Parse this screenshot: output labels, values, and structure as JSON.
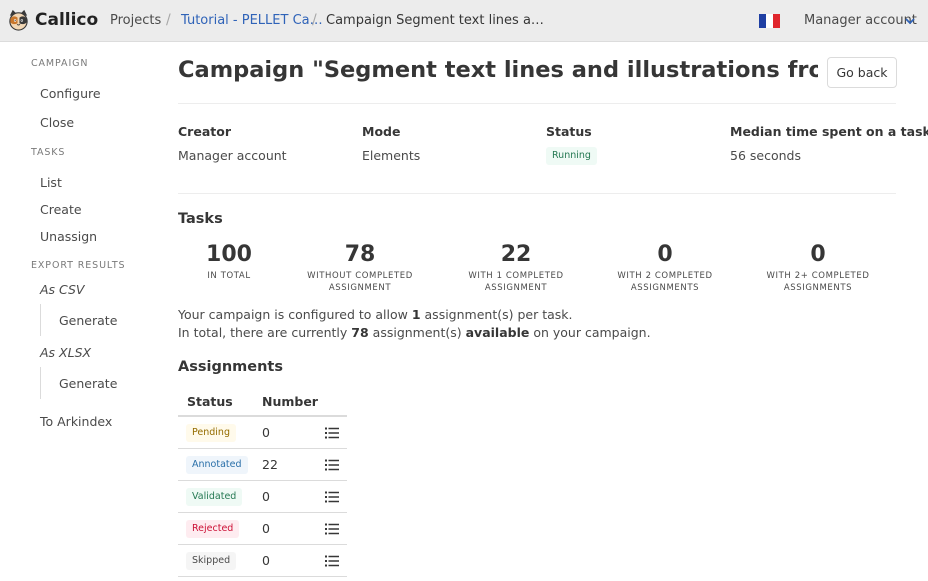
{
  "header": {
    "brand": "Callico",
    "breadcrumbs": [
      "Projects",
      "Tutorial - PELLET Ca…",
      "Campaign Segment text lines a…"
    ],
    "account": "Manager account",
    "language_flag": "fr"
  },
  "sidebar": {
    "campaign_label": "CAMPAIGN",
    "campaign_items": [
      "Configure",
      "Close"
    ],
    "tasks_label": "TASKS",
    "tasks_items": [
      "List",
      "Create",
      "Unassign"
    ],
    "export_label": "EXPORT RESULTS",
    "export_csv": "As CSV",
    "export_csv_sub": "Generate",
    "export_xlsx": "As XLSX",
    "export_xlsx_sub": "Generate",
    "arkindex": "To Arkindex"
  },
  "main": {
    "title": "Campaign \"Segment text lines and illustrations from ...",
    "go_back": "Go back",
    "info": {
      "creator_label": "Creator",
      "creator_value": "Manager account",
      "mode_label": "Mode",
      "mode_value": "Elements",
      "status_label": "Status",
      "status_value": "Running",
      "median_label": "Median time spent on a task",
      "median_value": "56 seconds"
    },
    "tasks_title": "Tasks",
    "stats": [
      {
        "num": "100",
        "line1": "IN TOTAL",
        "line2": ""
      },
      {
        "num": "78",
        "line1": "WITHOUT COMPLETED",
        "line2": "ASSIGNMENT"
      },
      {
        "num": "22",
        "line1": "WITH 1 COMPLETED",
        "line2": "ASSIGNMENT"
      },
      {
        "num": "0",
        "line1": "WITH 2 COMPLETED",
        "line2": "ASSIGNMENTS"
      },
      {
        "num": "0",
        "line1": "WITH 2+ COMPLETED",
        "line2": "ASSIGNMENTS"
      }
    ],
    "para1": {
      "pre": "Your campaign is configured to allow ",
      "bold": "1",
      "post": " assignment(s) per task."
    },
    "para2": {
      "pre": "In total, there are currently ",
      "bold1": "78",
      "mid": " assignment(s) ",
      "bold2": "available",
      "post": " on your campaign."
    },
    "assignments_title": "Assignments",
    "table": {
      "col_status": "Status",
      "col_number": "Number",
      "rows": [
        {
          "status": "Pending",
          "number": "0",
          "bg": "#fffaeb",
          "fg": "#946c00"
        },
        {
          "status": "Annotated",
          "number": "22",
          "bg": "#eff5fb",
          "fg": "#296fa8"
        },
        {
          "status": "Validated",
          "number": "0",
          "bg": "#effaf5",
          "fg": "#257953"
        },
        {
          "status": "Rejected",
          "number": "0",
          "bg": "#feecf0",
          "fg": "#cc0f35"
        },
        {
          "status": "Skipped",
          "number": "0",
          "bg": "#f5f5f5",
          "fg": "#4a4a4a"
        }
      ]
    }
  },
  "colors": {
    "link": "#2f63b8",
    "navbar": "#ececec"
  }
}
